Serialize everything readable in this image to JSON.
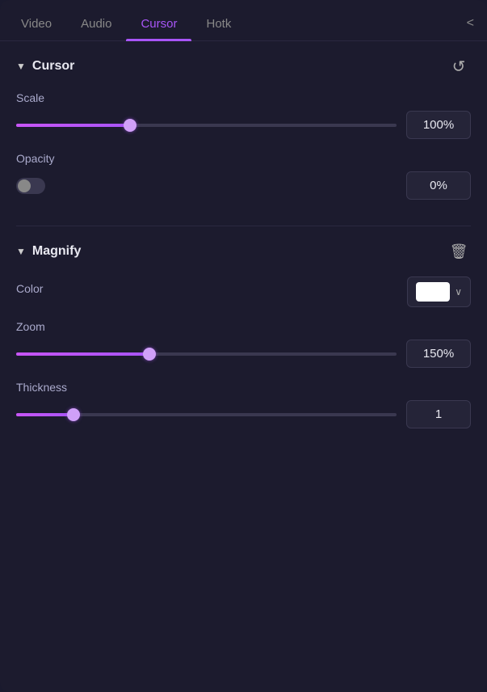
{
  "tabs": [
    {
      "id": "video",
      "label": "Video",
      "active": false
    },
    {
      "id": "audio",
      "label": "Audio",
      "active": false
    },
    {
      "id": "cursor",
      "label": "Cursor",
      "active": true
    },
    {
      "id": "hotkeys",
      "label": "Hotk",
      "active": false
    }
  ],
  "chevron_label": "<",
  "sections": {
    "cursor": {
      "title": "Cursor",
      "reset_icon": "↺",
      "controls": {
        "scale": {
          "label": "Scale",
          "value": "100%",
          "slider_fill_pct": 30,
          "thumb_pct": 30
        },
        "opacity": {
          "label": "Opacity",
          "value": "0%",
          "toggle_active": false
        }
      }
    },
    "magnify": {
      "title": "Magnify",
      "trash_icon": "🗑",
      "controls": {
        "color": {
          "label": "Color",
          "swatch_color": "#ffffff",
          "chevron": "∨"
        },
        "zoom": {
          "label": "Zoom",
          "value": "150%",
          "slider_fill_pct": 35,
          "thumb_pct": 35
        },
        "thickness": {
          "label": "Thickness",
          "value": "1",
          "slider_fill_pct": 15,
          "thumb_pct": 15
        }
      }
    }
  }
}
